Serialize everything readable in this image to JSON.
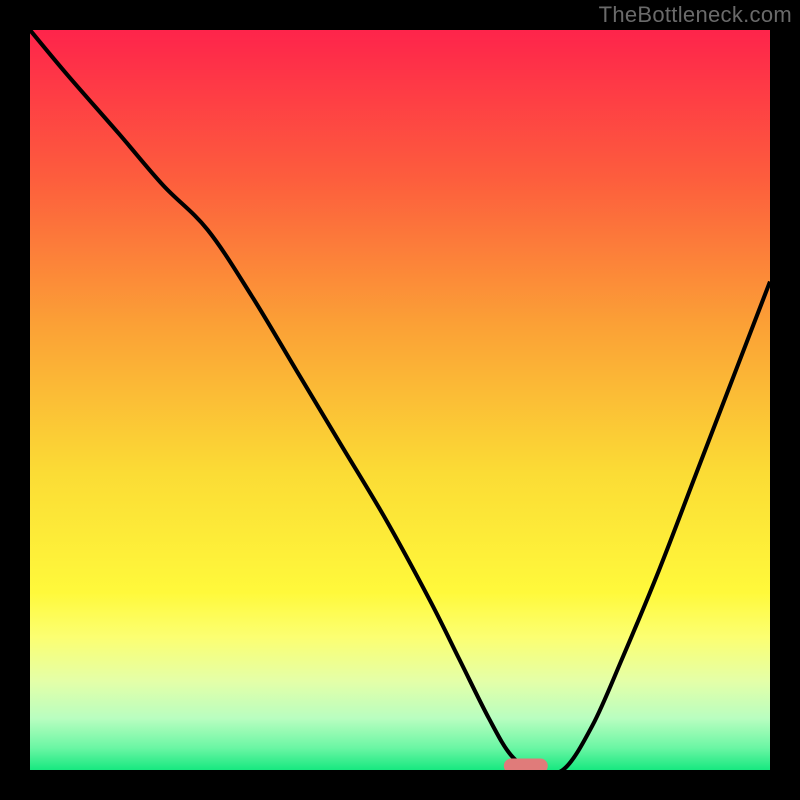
{
  "watermark": "TheBottleneck.com",
  "colors": {
    "black": "#000000",
    "curve": "#000000",
    "marker": "#e07b7a",
    "gradient_stops": [
      {
        "offset": 0.0,
        "color": "#fe244b"
      },
      {
        "offset": 0.2,
        "color": "#fd5d3d"
      },
      {
        "offset": 0.4,
        "color": "#fba136"
      },
      {
        "offset": 0.6,
        "color": "#fbdc35"
      },
      {
        "offset": 0.76,
        "color": "#fff93b"
      },
      {
        "offset": 0.82,
        "color": "#fcff71"
      },
      {
        "offset": 0.88,
        "color": "#e4ffa8"
      },
      {
        "offset": 0.93,
        "color": "#b9fec0"
      },
      {
        "offset": 0.97,
        "color": "#6bf6a4"
      },
      {
        "offset": 1.0,
        "color": "#17e880"
      }
    ]
  },
  "chart_data": {
    "type": "line",
    "title": "",
    "xlabel": "",
    "ylabel": "",
    "xlim": [
      0,
      100
    ],
    "ylim": [
      0,
      100
    ],
    "legend": false,
    "grid": false,
    "series": [
      {
        "name": "bottleneck-curve",
        "x": [
          0,
          5,
          12,
          18,
          24,
          30,
          36,
          42,
          48,
          54,
          58,
          62,
          65,
          68,
          72,
          76,
          80,
          85,
          90,
          95,
          100
        ],
        "y": [
          100,
          94,
          86,
          79,
          73,
          64,
          54,
          44,
          34,
          23,
          15,
          7,
          2,
          0,
          0,
          6,
          15,
          27,
          40,
          53,
          66
        ]
      }
    ],
    "annotations": [
      {
        "name": "optimal-marker",
        "shape": "pill",
        "x_center": 67,
        "y_center": 0.5,
        "width_pct": 6,
        "color": "#e07b7a"
      }
    ],
    "background": "vertical-gradient-red-to-green"
  }
}
